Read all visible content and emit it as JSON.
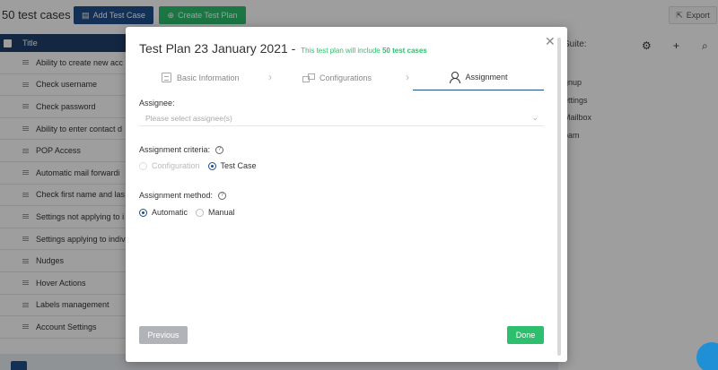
{
  "background": {
    "count_label": "50 test cases",
    "add_test_case_label": "Add Test Case",
    "create_test_plan_label": "Create Test Plan",
    "export_label": "Export",
    "table_header": "Title",
    "rows": [
      "Ability to create new acc",
      "Check username",
      "Check password",
      "Ability to enter contact d",
      "POP Access",
      "Automatic mail forwardi",
      "Check first name and las",
      "Settings not applying to i",
      "Settings applying to indiv",
      "Nudges",
      "Hover Actions",
      "Labels management",
      "Account Settings"
    ],
    "suite_title": "Suite:",
    "suite_items": [
      "gnup",
      "ettings",
      "Mailbox",
      "pam"
    ]
  },
  "modal": {
    "title": "Test Plan 23 January 2021",
    "dash": " - ",
    "subtitle_prefix": "This test plan will include ",
    "subtitle_count": "50 test cases",
    "steps": [
      {
        "label": "Basic Information",
        "icon": "document-icon"
      },
      {
        "label": "Configurations",
        "icon": "configurations-icon"
      },
      {
        "label": "Assignment",
        "icon": "user-icon"
      }
    ],
    "assignee_label": "Assignee:",
    "assignee_placeholder": "Please select assignee(s)",
    "criteria_label": "Assignment criteria:",
    "criteria_options": [
      "Configuration",
      "Test Case"
    ],
    "method_label": "Assignment method:",
    "method_options": [
      "Automatic",
      "Manual"
    ],
    "previous_label": "Previous",
    "done_label": "Done"
  },
  "colors": {
    "navy": "#1f4e8c",
    "green": "#2dbf6e",
    "overlay": "rgba(0,0,0,0.38)"
  }
}
